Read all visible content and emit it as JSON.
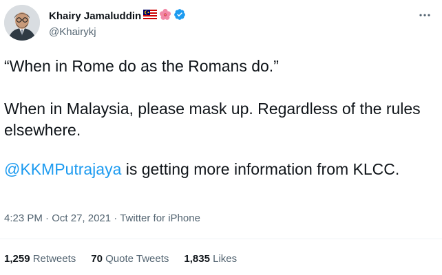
{
  "author": {
    "name": "Khairy Jamaluddin",
    "handle": "@Khairykj",
    "badges": [
      "malaysia-flag-icon",
      "hibiscus-icon",
      "verified-badge-icon"
    ],
    "verified_color": "#1d9bf0"
  },
  "more_icon": "more-options-icon",
  "tweet": {
    "line1": "“When in Rome do as the Romans do.”",
    "line2": "When in Malaysia, please mask up. Regardless of the rules elsewhere.",
    "mention": "@KKMPutrajaya",
    "line3_rest": " is getting more information from KLCC."
  },
  "meta": {
    "time": "4:23 PM",
    "date": "Oct 27, 2021",
    "source": "Twitter for iPhone",
    "sep": " · "
  },
  "stats": [
    {
      "count": "1,259",
      "label": "Retweets"
    },
    {
      "count": "70",
      "label": "Quote Tweets"
    },
    {
      "count": "1,835",
      "label": "Likes"
    }
  ],
  "colors": {
    "link": "#1d9bf0",
    "secondary": "#536471",
    "text": "#0f1419"
  }
}
